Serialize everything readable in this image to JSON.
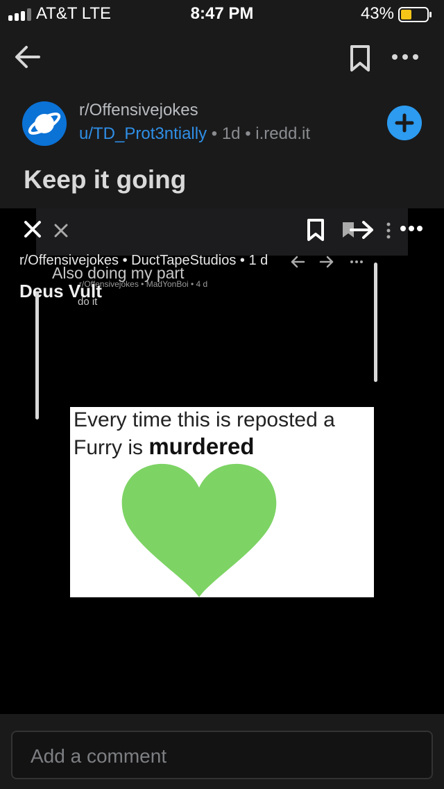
{
  "status_bar": {
    "carrier": "AT&T   LTE",
    "time": "8:47 PM",
    "battery_percent": "43%",
    "battery_level": 0.43,
    "battery_color": "#f5c518"
  },
  "header": {
    "back_icon": "arrow-left-icon",
    "bookmark_icon": "bookmark-icon",
    "more_icon": "more-horizontal-icon"
  },
  "post": {
    "subreddit": "r/Offensivejokes",
    "author": "u/TD_Prot3ntially",
    "age": "1d",
    "domain": "i.redd.it",
    "title": "Keep it going",
    "accent_color": "#2f8fe6"
  },
  "media": {
    "layer1": {
      "subreddit": "r/Offensivejokes",
      "author": "DuctTapeStudios",
      "age": "1 d",
      "title": "Deus Vult"
    },
    "layer2": {
      "title": "Also doing my part",
      "subreddit": "r/Offensivejokes",
      "author": "MadYonBoi",
      "age": "4 d",
      "subtitle": "do it"
    },
    "meme": {
      "line1": "Every time this is reposted a",
      "line2_prefix": "Furry is ",
      "line2_bold": "murdered",
      "heart_color": "#7dd364"
    }
  },
  "comment": {
    "placeholder": "Add a comment"
  }
}
